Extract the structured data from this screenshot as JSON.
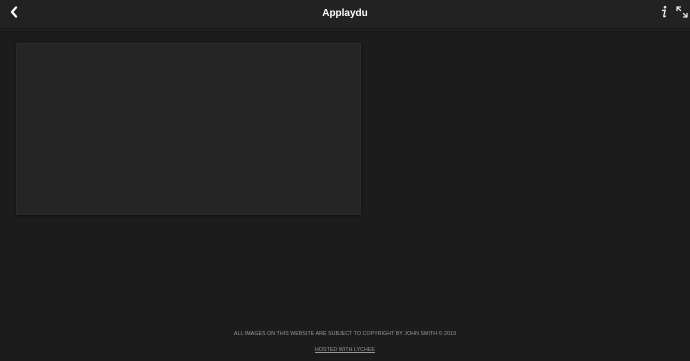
{
  "header": {
    "title": "Applaydu",
    "back_icon": "chevron-left-icon",
    "info_icon": "info-icon",
    "fullscreen_icon": "expand-icon"
  },
  "footer": {
    "copyright": "ALL IMAGES ON THIS WEBSITE ARE SUBJECT TO COPYRIGHT BY JOHN SMITH © 2019",
    "hosted": "HOSTED WITH LYCHEE"
  },
  "colors": {
    "background": "#1c1c1c",
    "header": "#222222",
    "panel": "#252525"
  }
}
